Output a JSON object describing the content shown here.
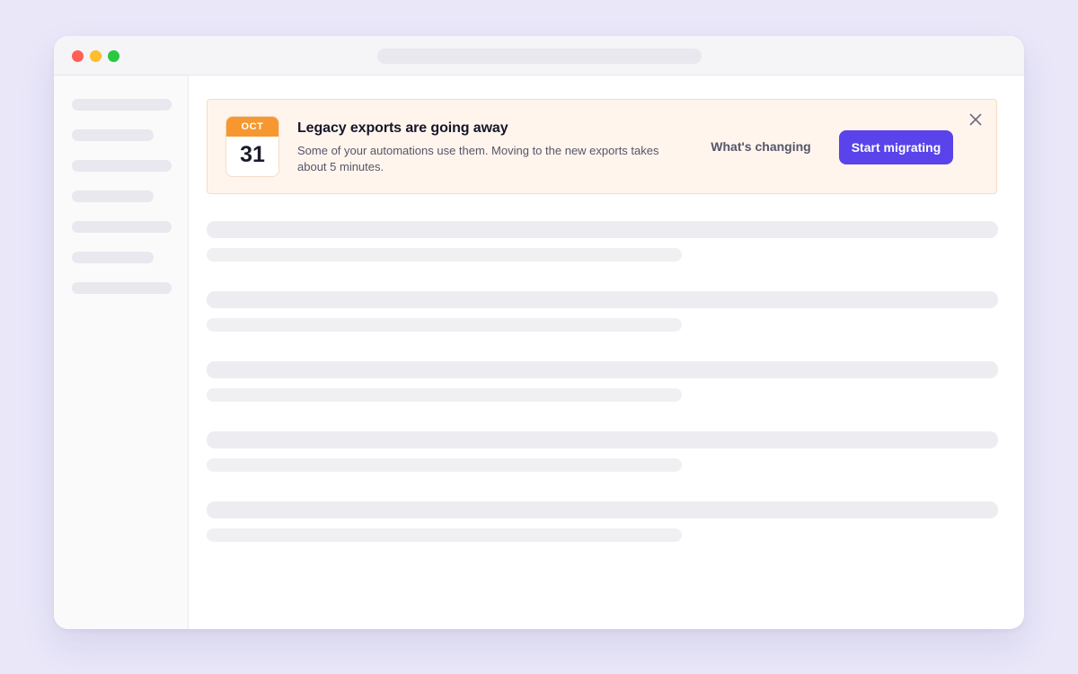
{
  "banner": {
    "calendar": {
      "month": "OCT",
      "day": "31"
    },
    "title": "Legacy exports are going away",
    "body": "Some of your automations use them. Moving to the new exports takes about 5 minutes.",
    "secondary_action": "What's changing",
    "primary_action": "Start migrating",
    "close_icon": "close-icon"
  },
  "colors": {
    "page_background": "#e9e7f8",
    "banner_background": "#fff5ed",
    "calendar_accent": "#f7972f",
    "primary_button": "#5a43ea"
  }
}
